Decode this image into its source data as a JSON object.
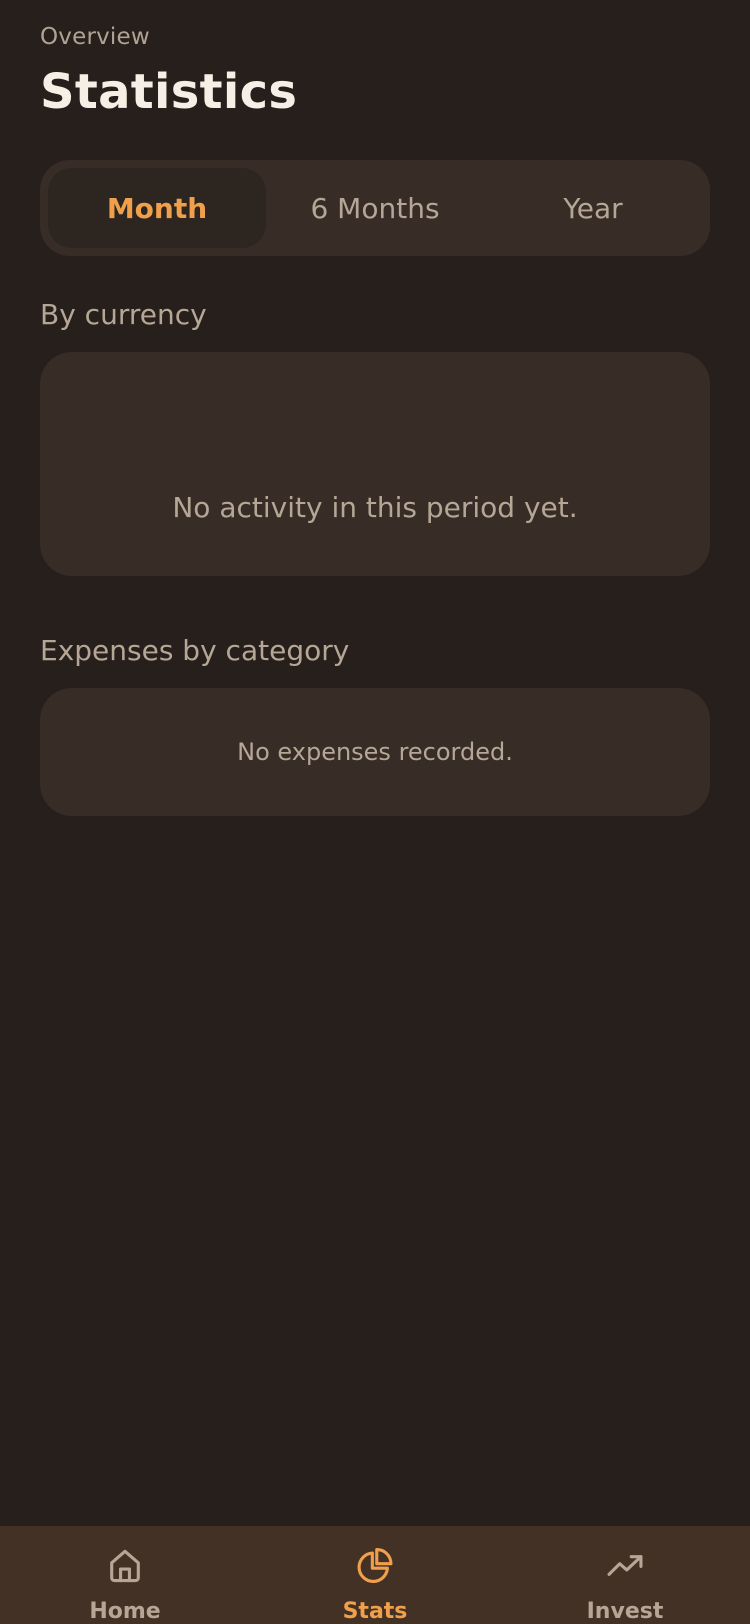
{
  "header": {
    "overline": "Overview",
    "title": "Statistics"
  },
  "period_selector": {
    "options": [
      "Month",
      "6 Months",
      "Year"
    ],
    "selected": "Month"
  },
  "sections": {
    "by_currency": {
      "label": "By currency",
      "empty_text": "No activity in this period yet."
    },
    "expenses_by_category": {
      "label": "Expenses by category",
      "empty_text": "No expenses recorded."
    }
  },
  "tabbar": {
    "items": [
      {
        "label": "Home",
        "icon": "home-icon",
        "active": false
      },
      {
        "label": "Stats",
        "icon": "pie-chart-icon",
        "active": true
      },
      {
        "label": "Invest",
        "icon": "trending-up-icon",
        "active": false
      }
    ]
  },
  "colors": {
    "background": "#261f1b",
    "card": "#372d26",
    "accent": "#f0a04b",
    "tabbar": "#433125",
    "muted_text": "#b5a696",
    "title_text": "#f7efe5"
  }
}
